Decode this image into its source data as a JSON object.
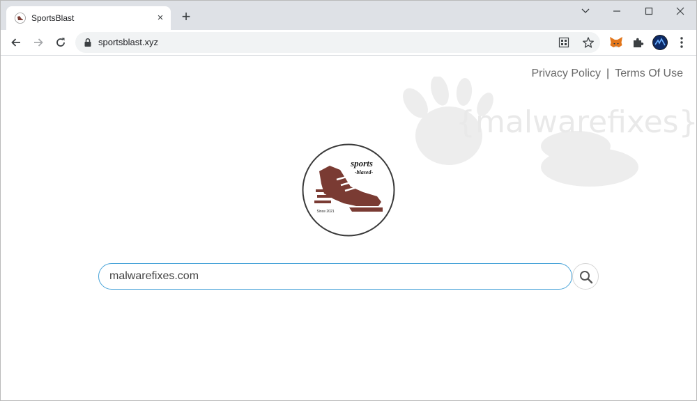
{
  "browser": {
    "tab": {
      "title": "SportsBlast",
      "close_label": "×"
    },
    "new_tab_label": "+",
    "url": "sportsblast.xyz",
    "window_controls": [
      "chevron-down-icon",
      "minimize-icon",
      "maximize-icon",
      "close-icon"
    ],
    "extensions": [
      "metamask-fox-icon",
      "puzzle-icon",
      "profile-avatar",
      "more-vert-icon"
    ]
  },
  "page": {
    "links": {
      "privacy": "Privacy Policy",
      "separator": "|",
      "terms": "Terms Of Use"
    },
    "watermark": "{malwarefixes}",
    "logo": {
      "line1": "sports",
      "line2": "-blased-",
      "since": "Since 2021"
    },
    "search": {
      "value": "malwarefixes.com",
      "border_color": "#4aa4d9"
    },
    "brand_color": "#7a3b33"
  }
}
